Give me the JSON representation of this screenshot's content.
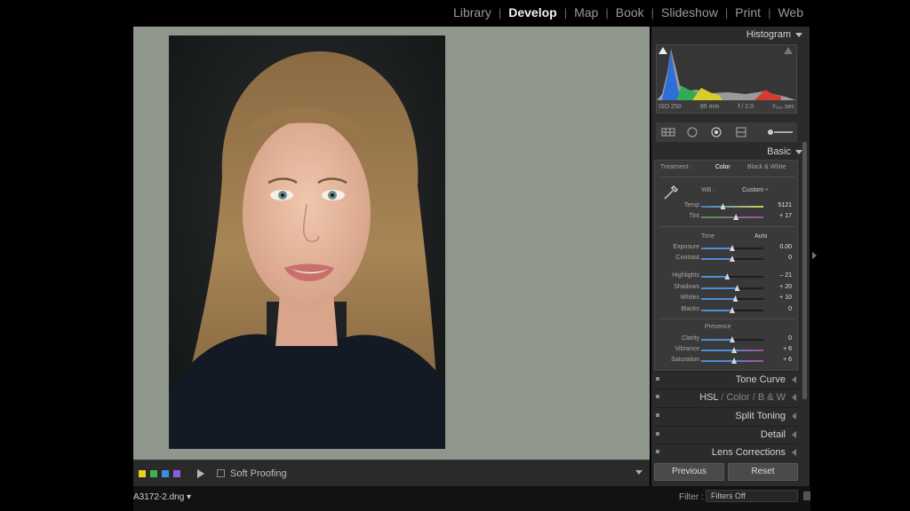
{
  "modules": [
    {
      "label": "Library",
      "active": false
    },
    {
      "label": "Develop",
      "active": true
    },
    {
      "label": "Map",
      "active": false
    },
    {
      "label": "Book",
      "active": false
    },
    {
      "label": "Slideshow",
      "active": false
    },
    {
      "label": "Print",
      "active": false
    },
    {
      "label": "Web",
      "active": false
    }
  ],
  "toolbar": {
    "soft_proofing": "Soft Proofing",
    "label_colors": [
      "#e6d21c",
      "#3cb44b",
      "#3a8fe0",
      "#8b5cd6"
    ]
  },
  "filmstrip": {
    "filename": "A3172-2.dng ▾",
    "filter_label": "Filter :",
    "filter_value": "Filters Off"
  },
  "histogram": {
    "title": "Histogram",
    "iso": "ISO 250",
    "focal": "85 mm",
    "aperture": "f / 2.0",
    "shutter": "¹⁄₂₅₀ sec"
  },
  "basic": {
    "title": "Basic",
    "treatment_label": "Treatment :",
    "treatment_color": "Color",
    "treatment_bw": "Black & White",
    "wb_label": "WB :",
    "wb_value": "Custom ÷",
    "tone_label": "Tone",
    "auto_label": "Auto",
    "presence_label": "Presence",
    "sliders": {
      "temp": {
        "label": "Temp",
        "value": "5121",
        "pos": 0.35
      },
      "tint": {
        "label": "Tint",
        "value": "+ 17",
        "pos": 0.56
      },
      "exposure": {
        "label": "Exposure",
        "value": "0.00",
        "pos": 0.5
      },
      "contrast": {
        "label": "Contrast",
        "value": "0",
        "pos": 0.5
      },
      "highlights": {
        "label": "Highlights",
        "value": "– 21",
        "pos": 0.42
      },
      "shadows": {
        "label": "Shadows",
        "value": "+ 20",
        "pos": 0.58
      },
      "whites": {
        "label": "Whites",
        "value": "+ 10",
        "pos": 0.55
      },
      "blacks": {
        "label": "Blacks",
        "value": "0",
        "pos": 0.5
      },
      "clarity": {
        "label": "Clarity",
        "value": "0",
        "pos": 0.5
      },
      "vibrance": {
        "label": "Vibrance",
        "value": "+ 6",
        "pos": 0.53
      },
      "saturation": {
        "label": "Saturation",
        "value": "+ 6",
        "pos": 0.53
      }
    }
  },
  "panels": {
    "tone_curve": "Tone Curve",
    "hsl_a": "HSL",
    "hsl_sep": " / ",
    "hsl_b": "Color",
    "hsl_c": "B & W",
    "split_toning": "Split Toning",
    "detail": "Detail",
    "lens_corrections": "Lens Corrections"
  },
  "buttons": {
    "previous": "Previous",
    "reset": "Reset"
  }
}
